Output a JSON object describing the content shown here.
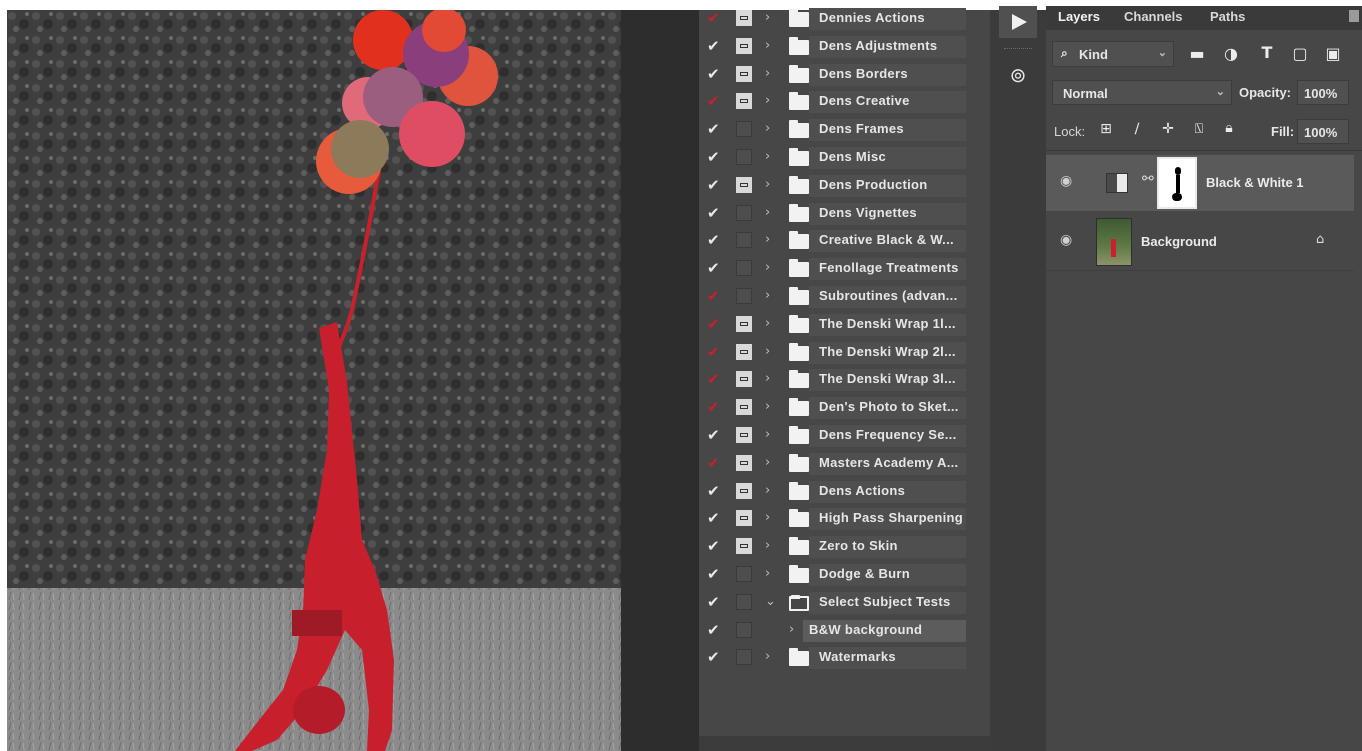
{
  "colors": {
    "checkmark_red": "#c8202c",
    "panel_bg": "#474747",
    "accent_subject": "#d8283a"
  },
  "actions_panel": {
    "items": [
      {
        "label": "Dennies Actions",
        "check_red": true,
        "dialog": true,
        "expanded": false
      },
      {
        "label": "Dens Adjustments",
        "check_red": false,
        "dialog": true,
        "expanded": false
      },
      {
        "label": "Dens Borders",
        "check_red": false,
        "dialog": true,
        "expanded": false
      },
      {
        "label": "Dens Creative",
        "check_red": true,
        "dialog": true,
        "expanded": false
      },
      {
        "label": "Dens Frames",
        "check_red": false,
        "dialog": false,
        "expanded": false
      },
      {
        "label": "Dens Misc",
        "check_red": false,
        "dialog": false,
        "expanded": false
      },
      {
        "label": "Dens Production",
        "check_red": false,
        "dialog": true,
        "expanded": false
      },
      {
        "label": "Dens Vignettes",
        "check_red": false,
        "dialog": false,
        "expanded": false
      },
      {
        "label": "Creative Black & W...",
        "check_red": false,
        "dialog": false,
        "expanded": false
      },
      {
        "label": "Fenollage Treatments",
        "check_red": false,
        "dialog": false,
        "expanded": false
      },
      {
        "label": "Subroutines (advan...",
        "check_red": true,
        "dialog": false,
        "expanded": false
      },
      {
        "label": "The Denski Wrap 1l...",
        "check_red": true,
        "dialog": true,
        "expanded": false
      },
      {
        "label": "The Denski Wrap 2l...",
        "check_red": true,
        "dialog": true,
        "expanded": false
      },
      {
        "label": "The Denski Wrap 3l...",
        "check_red": true,
        "dialog": true,
        "expanded": false
      },
      {
        "label": "Den's Photo to Sket...",
        "check_red": true,
        "dialog": true,
        "expanded": false
      },
      {
        "label": "Dens Frequency Se...",
        "check_red": false,
        "dialog": true,
        "expanded": false
      },
      {
        "label": "Masters Academy A...",
        "check_red": true,
        "dialog": true,
        "expanded": false
      },
      {
        "label": "Dens Actions",
        "check_red": false,
        "dialog": true,
        "expanded": false
      },
      {
        "label": "High Pass Sharpening",
        "check_red": false,
        "dialog": true,
        "expanded": false
      },
      {
        "label": "Zero to Skin",
        "check_red": false,
        "dialog": true,
        "expanded": false
      },
      {
        "label": "Dodge & Burn",
        "check_red": false,
        "dialog": false,
        "expanded": false
      },
      {
        "label": "Select Subject Tests",
        "check_red": false,
        "dialog": false,
        "expanded": true
      },
      {
        "label": "B&W background",
        "check_red": false,
        "dialog": false,
        "expanded": false,
        "is_action": true,
        "selected": true
      },
      {
        "label": "Watermarks",
        "check_red": false,
        "dialog": false,
        "expanded": false
      }
    ]
  },
  "toolstrip": {
    "play_icon": "play-icon",
    "cloud_icon": "creative-cloud-libraries-icon"
  },
  "layers_panel": {
    "tabs": [
      "Layers",
      "Channels",
      "Paths"
    ],
    "active_tab": "Layers",
    "filter": {
      "label": "Kind"
    },
    "blend_mode": "Normal",
    "opacity_label": "Opacity:",
    "opacity_value": "100%",
    "lock_label": "Lock:",
    "fill_label": "Fill:",
    "fill_value": "100%",
    "layers": [
      {
        "name": "Black & White 1",
        "type": "adjustment",
        "selected": true,
        "visible": true
      },
      {
        "name": "Background",
        "type": "image",
        "selected": false,
        "visible": true,
        "locked": true
      }
    ]
  }
}
